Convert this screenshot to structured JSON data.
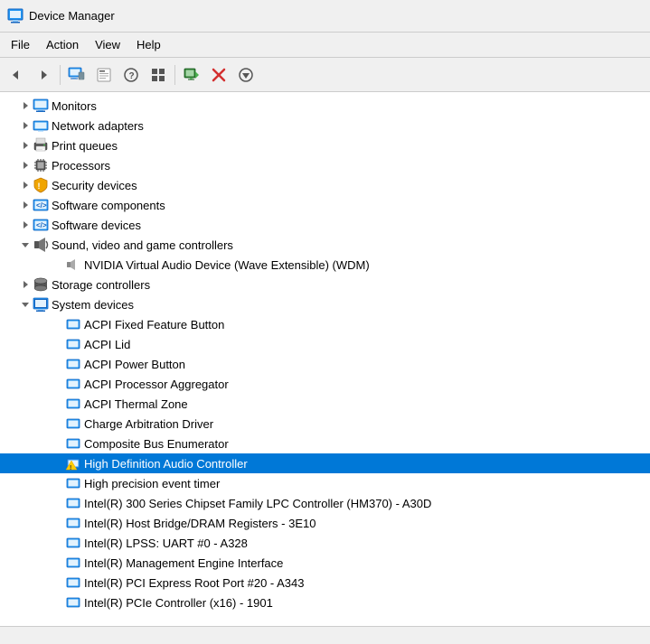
{
  "titleBar": {
    "title": "Device Manager",
    "icon": "🖥️"
  },
  "menuBar": {
    "items": [
      {
        "label": "File",
        "id": "file"
      },
      {
        "label": "Action",
        "id": "action"
      },
      {
        "label": "View",
        "id": "view"
      },
      {
        "label": "Help",
        "id": "help"
      }
    ]
  },
  "toolbar": {
    "buttons": [
      {
        "id": "back",
        "icon": "◀",
        "title": "Back"
      },
      {
        "id": "forward",
        "icon": "▶",
        "title": "Forward"
      },
      {
        "id": "computer",
        "icon": "🖥",
        "title": "Computer Management"
      },
      {
        "id": "properties",
        "icon": "📋",
        "title": "Properties"
      },
      {
        "id": "help",
        "icon": "?",
        "title": "Help"
      },
      {
        "id": "grid",
        "icon": "⊞",
        "title": "Grid"
      },
      {
        "id": "monitor",
        "icon": "🖥",
        "title": "Monitor"
      },
      {
        "id": "scan",
        "icon": "🔍",
        "title": "Scan"
      },
      {
        "id": "delete",
        "icon": "✕",
        "title": "Delete"
      },
      {
        "id": "update",
        "icon": "⬇",
        "title": "Update"
      }
    ]
  },
  "treeItems": [
    {
      "id": "monitors",
      "label": "Monitors",
      "indent": 1,
      "expanded": false,
      "hasChildren": true,
      "iconType": "monitor",
      "selected": false
    },
    {
      "id": "network-adapters",
      "label": "Network adapters",
      "indent": 1,
      "expanded": false,
      "hasChildren": true,
      "iconType": "network",
      "selected": false
    },
    {
      "id": "print-queues",
      "label": "Print queues",
      "indent": 1,
      "expanded": false,
      "hasChildren": true,
      "iconType": "print",
      "selected": false
    },
    {
      "id": "processors",
      "label": "Processors",
      "indent": 1,
      "expanded": false,
      "hasChildren": true,
      "iconType": "processor",
      "selected": false
    },
    {
      "id": "security-devices",
      "label": "Security devices",
      "indent": 1,
      "expanded": false,
      "hasChildren": true,
      "iconType": "security",
      "selected": false
    },
    {
      "id": "software-components",
      "label": "Software components",
      "indent": 1,
      "expanded": false,
      "hasChildren": true,
      "iconType": "software",
      "selected": false
    },
    {
      "id": "software-devices",
      "label": "Software devices",
      "indent": 1,
      "expanded": false,
      "hasChildren": true,
      "iconType": "software",
      "selected": false
    },
    {
      "id": "sound-video",
      "label": "Sound, video and game controllers",
      "indent": 1,
      "expanded": true,
      "hasChildren": true,
      "iconType": "sound",
      "selected": false
    },
    {
      "id": "nvidia-audio",
      "label": "NVIDIA Virtual Audio Device (Wave Extensible) (WDM)",
      "indent": 2,
      "expanded": false,
      "hasChildren": false,
      "iconType": "sound-child",
      "selected": false
    },
    {
      "id": "storage-controllers",
      "label": "Storage controllers",
      "indent": 1,
      "expanded": false,
      "hasChildren": true,
      "iconType": "storage",
      "selected": false
    },
    {
      "id": "system-devices",
      "label": "System devices",
      "indent": 1,
      "expanded": true,
      "hasChildren": true,
      "iconType": "system",
      "selected": false
    },
    {
      "id": "acpi-fixed",
      "label": "ACPI Fixed Feature Button",
      "indent": 2,
      "expanded": false,
      "hasChildren": false,
      "iconType": "device",
      "selected": false
    },
    {
      "id": "acpi-lid",
      "label": "ACPI Lid",
      "indent": 2,
      "expanded": false,
      "hasChildren": false,
      "iconType": "device",
      "selected": false
    },
    {
      "id": "acpi-power",
      "label": "ACPI Power Button",
      "indent": 2,
      "expanded": false,
      "hasChildren": false,
      "iconType": "device",
      "selected": false
    },
    {
      "id": "acpi-processor",
      "label": "ACPI Processor Aggregator",
      "indent": 2,
      "expanded": false,
      "hasChildren": false,
      "iconType": "device",
      "selected": false
    },
    {
      "id": "acpi-thermal",
      "label": "ACPI Thermal Zone",
      "indent": 2,
      "expanded": false,
      "hasChildren": false,
      "iconType": "device",
      "selected": false
    },
    {
      "id": "charge-arbitration",
      "label": "Charge Arbitration Driver",
      "indent": 2,
      "expanded": false,
      "hasChildren": false,
      "iconType": "device",
      "selected": false
    },
    {
      "id": "composite-bus",
      "label": "Composite Bus Enumerator",
      "indent": 2,
      "expanded": false,
      "hasChildren": false,
      "iconType": "device",
      "selected": false
    },
    {
      "id": "hd-audio",
      "label": "High Definition Audio Controller",
      "indent": 2,
      "expanded": false,
      "hasChildren": false,
      "iconType": "device-warning",
      "selected": true
    },
    {
      "id": "high-precision",
      "label": "High precision event timer",
      "indent": 2,
      "expanded": false,
      "hasChildren": false,
      "iconType": "device",
      "selected": false
    },
    {
      "id": "intel-chipset",
      "label": "Intel(R) 300 Series Chipset Family LPC Controller (HM370) - A30D",
      "indent": 2,
      "expanded": false,
      "hasChildren": false,
      "iconType": "device",
      "selected": false
    },
    {
      "id": "intel-host-bridge",
      "label": "Intel(R) Host Bridge/DRAM Registers - 3E10",
      "indent": 2,
      "expanded": false,
      "hasChildren": false,
      "iconType": "device",
      "selected": false
    },
    {
      "id": "intel-lpss",
      "label": "Intel(R) LPSS: UART #0 - A328",
      "indent": 2,
      "expanded": false,
      "hasChildren": false,
      "iconType": "device",
      "selected": false
    },
    {
      "id": "intel-mgmt",
      "label": "Intel(R) Management Engine Interface",
      "indent": 2,
      "expanded": false,
      "hasChildren": false,
      "iconType": "device",
      "selected": false
    },
    {
      "id": "intel-pci",
      "label": "Intel(R) PCI Express Root Port #20 - A343",
      "indent": 2,
      "expanded": false,
      "hasChildren": false,
      "iconType": "device",
      "selected": false
    },
    {
      "id": "intel-pcie",
      "label": "Intel(R) PCIe Controller (x16) - 1901",
      "indent": 2,
      "expanded": false,
      "hasChildren": false,
      "iconType": "device",
      "selected": false
    }
  ],
  "statusBar": {
    "text": ""
  }
}
